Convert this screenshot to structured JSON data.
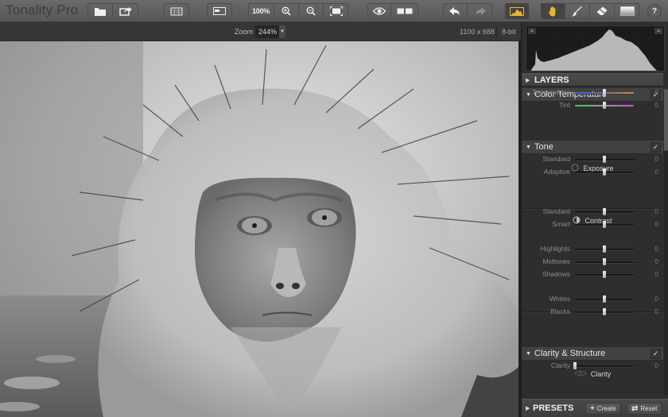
{
  "app": {
    "title": "Tonality Pro"
  },
  "toolbar": {
    "file_group": [
      {
        "name": "open-button",
        "icon": "folder-icon"
      },
      {
        "name": "export-button",
        "icon": "share-icon"
      }
    ],
    "crop_icon": "crop-grid-icon",
    "panel_icon": "panel-toggle-icon",
    "zoom_group": {
      "actual_size_label": "100%",
      "zoom_in_icon": "zoom-in-icon",
      "zoom_out_icon": "zoom-out-icon",
      "fit_icon": "fit-screen-icon"
    },
    "view_group": [
      {
        "name": "preview-button",
        "icon": "eye-icon"
      },
      {
        "name": "compare-button",
        "icon": "split-view-icon"
      }
    ],
    "history_group": [
      {
        "name": "undo-button",
        "icon": "undo-icon"
      },
      {
        "name": "redo-button",
        "icon": "redo-icon"
      }
    ],
    "histogram_toggle": {
      "icon": "histogram-icon",
      "active": true,
      "accent": "#e8b530"
    },
    "tools": [
      {
        "name": "hand-tool",
        "icon": "hand-icon",
        "active": true
      },
      {
        "name": "brush-tool",
        "icon": "brush-icon",
        "active": false
      },
      {
        "name": "eraser-tool",
        "icon": "eraser-icon",
        "active": false
      },
      {
        "name": "gradient-tool",
        "icon": "gradient-icon",
        "active": false
      }
    ],
    "help_label": "?"
  },
  "infobar": {
    "zoom_label": "Zoom",
    "zoom_value": "244%",
    "dimensions": "1100 x 688",
    "bit_depth": "8-bit"
  },
  "canvas": {
    "image_description": "Black and white close-up portrait of a wet snow monkey (Japanese macaque) with spiky fur, water in background"
  },
  "panel": {
    "layers_label": "LAYERS",
    "sections": [
      {
        "title": "Color Temperature",
        "checked": true,
        "sliders": [
          {
            "label": "Temperature",
            "value": "0",
            "position": 0.5,
            "track": "temperature"
          },
          {
            "label": "Tint",
            "value": "0",
            "position": 0.5,
            "track": "tint"
          }
        ]
      },
      {
        "title": "Tone",
        "checked": true,
        "groups": [
          {
            "title": "Exposure",
            "icon": "exposure-icon",
            "sliders": [
              {
                "label": "Standard",
                "value": "0",
                "position": 0.5
              },
              {
                "label": "Adaptive",
                "value": "0",
                "position": 0.5
              }
            ]
          },
          {
            "title": "Contrast",
            "icon": "contrast-icon",
            "sliders": [
              {
                "label": "Standard",
                "value": "0",
                "position": 0.5
              },
              {
                "label": "Smart",
                "value": "0",
                "position": 0.5
              }
            ]
          },
          {
            "title": "",
            "sliders": [
              {
                "label": "Highlights",
                "value": "0",
                "position": 0.5
              },
              {
                "label": "Midtones",
                "value": "0",
                "position": 0.5
              },
              {
                "label": "Shadows",
                "value": "0",
                "position": 0.5
              }
            ]
          },
          {
            "title": "",
            "sliders": [
              {
                "label": "Whites",
                "value": "0",
                "position": 0.5
              },
              {
                "label": "Blacks",
                "value": "0",
                "position": 0.5
              }
            ]
          }
        ]
      },
      {
        "title": "Clarity & Structure",
        "checked": true,
        "groups": [
          {
            "title": "Clarity",
            "icon": "clarity-eye-icon",
            "sliders": [
              {
                "label": "Clarity",
                "value": "0",
                "position": 0.0
              }
            ]
          }
        ]
      }
    ],
    "presets": {
      "label": "PRESETS",
      "create_label": "Create",
      "reset_label": "Reset"
    }
  },
  "colors": {
    "accent": "#e8b530",
    "temperature_track": [
      "#3a5ee0",
      "#e08a2a"
    ],
    "tint_track": [
      "#3ad03a",
      "#e040e0"
    ]
  }
}
